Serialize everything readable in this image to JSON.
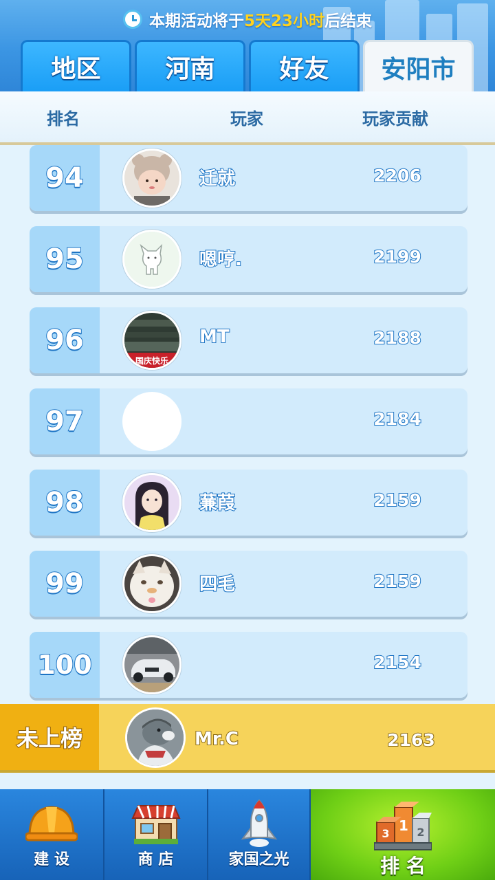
{
  "timer": {
    "prefix": "本期活动将于",
    "highlight": "5天23小时",
    "suffix": "后结束"
  },
  "tabs": [
    {
      "label": "地区"
    },
    {
      "label": "河南"
    },
    {
      "label": "好友"
    },
    {
      "label": "安阳市"
    }
  ],
  "header": {
    "rank": "排名",
    "player": "玩家",
    "contribution": "玩家贡献"
  },
  "rows": [
    {
      "rank": "94",
      "name": "迁就",
      "score": "2206"
    },
    {
      "rank": "95",
      "name": "嗯哼.",
      "score": "2199"
    },
    {
      "rank": "96",
      "name": "MT",
      "score": "2188",
      "avatar_text": "国庆快乐"
    },
    {
      "rank": "97",
      "name": "",
      "score": "2184"
    },
    {
      "rank": "98",
      "name": "蒹葭",
      "score": "2159"
    },
    {
      "rank": "99",
      "name": "四毛",
      "score": "2159"
    },
    {
      "rank": "100",
      "name": "",
      "score": "2154"
    }
  ],
  "me": {
    "label": "未上榜",
    "name": "Mr.C",
    "score": "2163"
  },
  "nav": [
    {
      "label": "建 设",
      "icon": "hardhat-icon"
    },
    {
      "label": "商 店",
      "icon": "shop-icon"
    },
    {
      "label": "家国之光",
      "icon": "rocket-icon"
    },
    {
      "label": "排 名",
      "icon": "podium-icon"
    }
  ],
  "colors": {
    "accent": "#1d74c4",
    "tab_blue": "#1a9ef6",
    "highlight": "#ffd21e",
    "me_bg": "#f6d35a",
    "nav_active": "#6fcf16"
  }
}
